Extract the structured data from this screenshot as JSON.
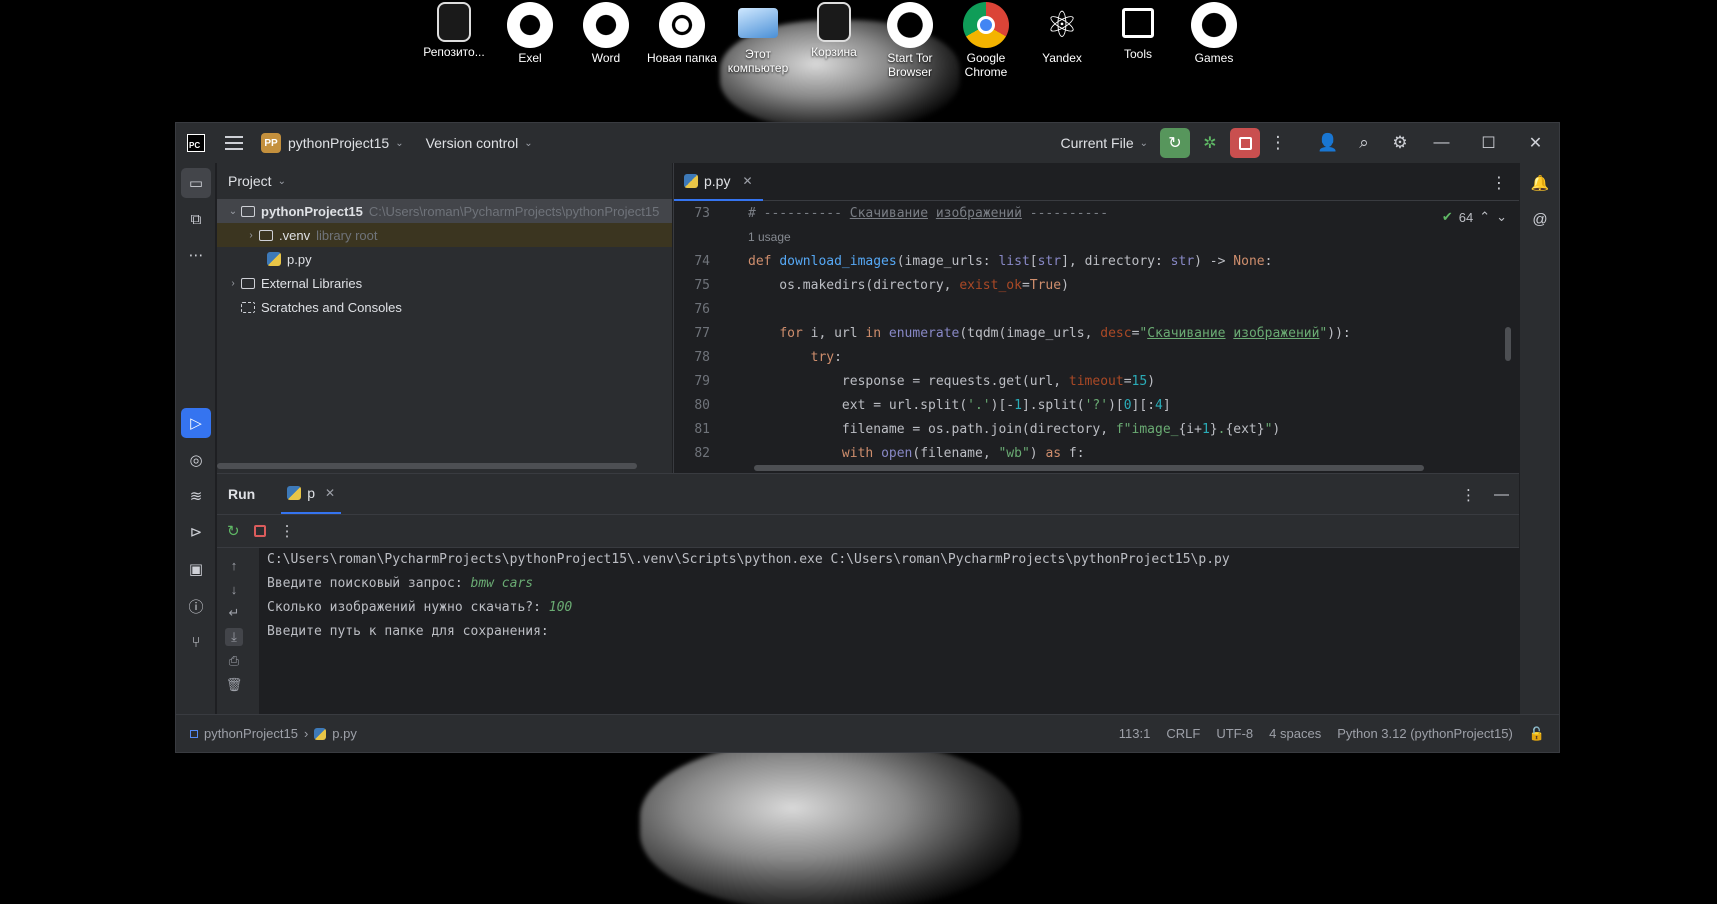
{
  "desktop": {
    "icons": [
      {
        "label": "Репозито...",
        "icon": "recycle-bin-style-icon"
      },
      {
        "label": "Exel",
        "icon": "aperture-icon"
      },
      {
        "label": "Word",
        "icon": "aperture-icon"
      },
      {
        "label": "Новая папка",
        "icon": "ring-icon"
      },
      {
        "label": "Этот компьютер",
        "icon": "computer-icon"
      },
      {
        "label": "Корзина",
        "icon": "recycle-bin-icon"
      },
      {
        "label": "Start Tor Browser",
        "icon": "tor-icon"
      },
      {
        "label": "Google Chrome",
        "icon": "chrome-icon"
      },
      {
        "label": "Yandex",
        "icon": "atom-icon"
      },
      {
        "label": "Tools",
        "icon": "folder-icon"
      },
      {
        "label": "Games",
        "icon": "gauge-icon"
      }
    ]
  },
  "titlebar": {
    "logo": "PC",
    "project_badge": "PP",
    "project_name": "pythonProject15",
    "version_control": "Version control",
    "run_config": "Current File"
  },
  "project_pane": {
    "header": "Project",
    "tree": [
      {
        "label": "pythonProject15",
        "hint": "C:\\Users\\roman\\PycharmProjects\\pythonProject15"
      },
      {
        "label": ".venv",
        "hint": "library root"
      },
      {
        "label": "p.py",
        "hint": ""
      },
      {
        "label": "External Libraries",
        "hint": ""
      },
      {
        "label": "Scratches and Consoles",
        "hint": ""
      }
    ]
  },
  "editor": {
    "tab": "p.py",
    "inspection_count": "64",
    "usage": "1 usage",
    "line_numbers": [
      "73",
      "74",
      "75",
      "76",
      "77",
      "78",
      "79",
      "80",
      "81",
      "82"
    ]
  },
  "run_panel": {
    "title": "Run",
    "tab": "p",
    "console": [
      {
        "text": "C:\\Users\\roman\\PycharmProjects\\pythonProject15\\.venv\\Scripts\\python.exe C:\\Users\\roman\\PycharmProjects\\pythonProject15\\p.py",
        "input": ""
      },
      {
        "text": "Введите поисковый запрос: ",
        "input": "bmw cars"
      },
      {
        "text": "Сколько изображений нужно скачать?: ",
        "input": "100"
      },
      {
        "text": "Введите путь к папке для сохранения: ",
        "input": ""
      }
    ]
  },
  "statusbar": {
    "project": "pythonProject15",
    "file": "p.py",
    "position": "113:1",
    "line_sep": "CRLF",
    "encoding": "UTF-8",
    "indent": "4 spaces",
    "interpreter": "Python 3.12 (pythonProject15)"
  }
}
